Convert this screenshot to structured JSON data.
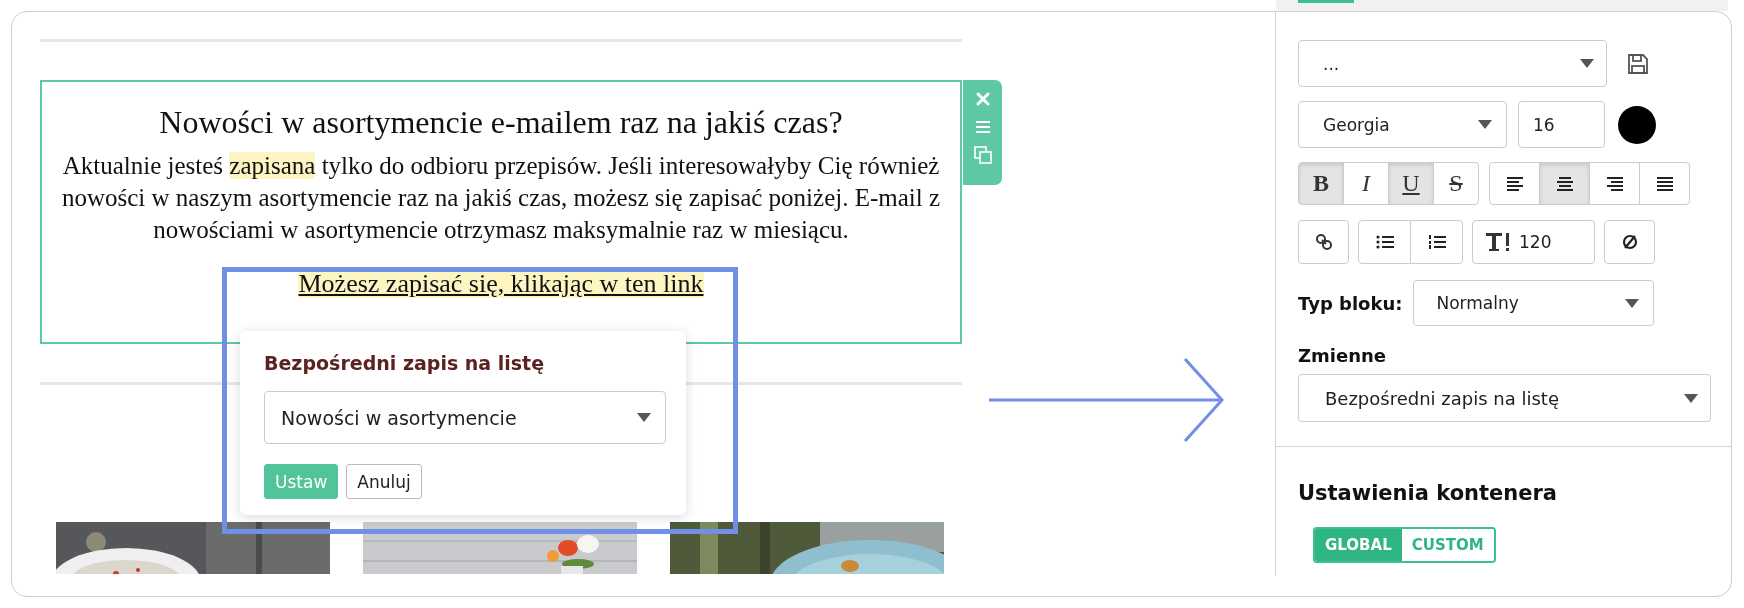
{
  "editor": {
    "block": {
      "selected": true,
      "heading": "Nowości w asortymencie e-mailem raz na jakiś czas?",
      "paragraph": [
        {
          "text": "Aktualnie jesteś ",
          "highlighted": false
        },
        {
          "text": "zapisana",
          "highlighted": true
        },
        {
          "text": " tylko do odbioru przepisów. Jeśli interesowałyby Cię również nowości w naszym asortymencie raz na jakiś czas, możesz się zapisać poniżej. E-mail z nowościami w asortymencie otrzymasz maksymalnie raz w miesiącu.",
          "highlighted": false
        }
      ],
      "link": {
        "text": "Możesz zapisać się, klikając w ten link",
        "highlighted": true
      }
    },
    "popup": {
      "title": "Bezpośredni zapis na listę",
      "select": {
        "value": "Nowości w asortymencie"
      },
      "buttons": [
        {
          "label": "Ustaw",
          "kind": "primary"
        },
        {
          "label": "Anuluj",
          "kind": "secondary"
        }
      ]
    }
  },
  "panel": {
    "style_select": {
      "value": "..."
    },
    "font_select": {
      "value": "Georgia"
    },
    "font_size": {
      "value": "16"
    },
    "text_color": {
      "color": "#000000"
    },
    "format_buttons": [
      {
        "kind": "bold",
        "label": "B",
        "selected": true
      },
      {
        "kind": "italic",
        "label": "I",
        "selected": false
      },
      {
        "kind": "underline",
        "label": "U",
        "selected": true
      },
      {
        "kind": "strike",
        "label": "S",
        "selected": false
      }
    ],
    "align_buttons": [
      {
        "kind": "left",
        "selected": false
      },
      {
        "kind": "center",
        "selected": true
      },
      {
        "kind": "right",
        "selected": false
      },
      {
        "kind": "justify",
        "selected": false
      }
    ],
    "line_height": {
      "value": "120"
    },
    "block_type": {
      "label": "Typ bloku:",
      "value": "Normalny"
    },
    "variables": {
      "label": "Zmienne",
      "value": "Bezpośredni zapis na listę"
    },
    "container": {
      "title": "Ustawienia kontenera",
      "toggle": [
        {
          "label": "GLOBAL",
          "selected": true
        },
        {
          "label": "CUSTOM",
          "selected": false
        }
      ]
    }
  }
}
